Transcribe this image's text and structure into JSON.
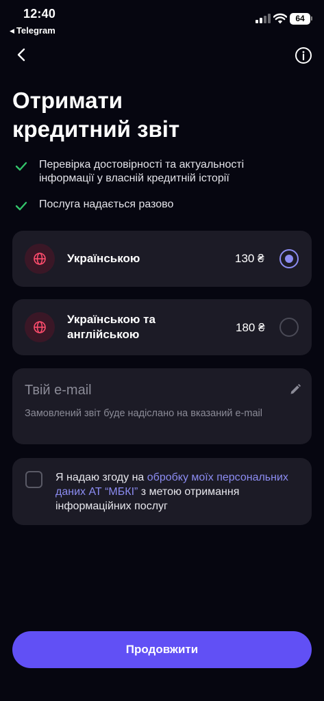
{
  "status_bar": {
    "time": "12:40",
    "back_app": "Telegram",
    "battery": "64"
  },
  "nav": {
    "back_icon": "chevron-left-icon",
    "info_icon": "info-icon"
  },
  "page": {
    "title_line1": "Отримати",
    "title_line2": "кредитний звіт"
  },
  "benefits": [
    {
      "text": "Перевірка достовірності та актуальності інформації у власній кредитній історії"
    },
    {
      "text": "Послуга надається разово"
    }
  ],
  "options": [
    {
      "label_line1": "Українською",
      "label_line2": "",
      "price": "130 ₴",
      "selected": true,
      "icon": "globe-icon"
    },
    {
      "label_line1": "Українською та",
      "label_line2": "англійською",
      "price": "180 ₴",
      "selected": false,
      "icon": "globe-icon"
    }
  ],
  "email": {
    "placeholder": "Твій e-mail",
    "value": "",
    "hint": "Замовлений звіт буде надіслано на вказаний e-mail",
    "edit_icon": "pencil-icon"
  },
  "consent": {
    "checked": false,
    "text_before": "Я надаю згоду на ",
    "link_text": "обробку моїх персональних даних АТ “МБКІ”",
    "text_after": " з метою отримання інформаційних послуг"
  },
  "continue_button": {
    "label": "Продовжити"
  },
  "colors": {
    "background": "#060610",
    "card": "#1c1b26",
    "accent": "#6150f5",
    "radio_selected": "#8c8cf2",
    "check": "#33c46b",
    "globe": "#ff4d6d"
  }
}
